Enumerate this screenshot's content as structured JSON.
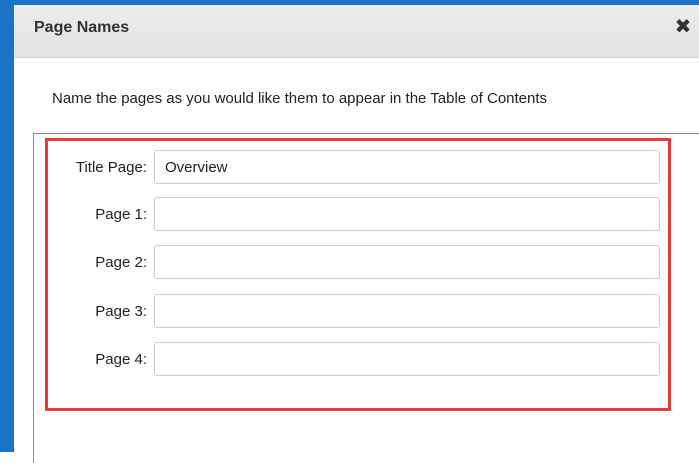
{
  "dialog": {
    "title": "Page Names",
    "close_symbol": "✖",
    "instructions": "Name the pages as you would like them to appear in the Table of Contents"
  },
  "fields": [
    {
      "label": "Title Page:",
      "value": "Overview"
    },
    {
      "label": "Page 1:",
      "value": ""
    },
    {
      "label": "Page 2:",
      "value": ""
    },
    {
      "label": "Page 3:",
      "value": ""
    },
    {
      "label": "Page 4:",
      "value": ""
    }
  ],
  "colors": {
    "frame": "#1a73c6",
    "highlight": "#e53b3b"
  }
}
